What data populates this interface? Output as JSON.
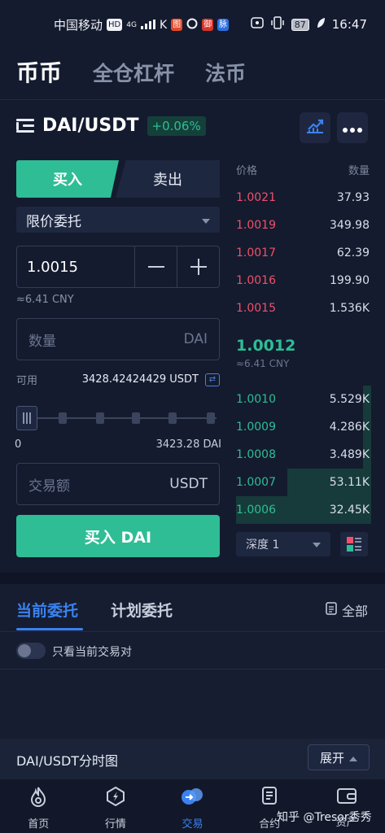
{
  "status_bar": {
    "carrier": "中国移动",
    "hd_badge": "HD",
    "network": "4G",
    "battery": "87",
    "time": "16:47",
    "app_badges": [
      "图",
      "御",
      "脉"
    ]
  },
  "top_tabs": [
    {
      "label": "币币",
      "active": true
    },
    {
      "label": "全仓杠杆",
      "active": false
    },
    {
      "label": "法币",
      "active": false
    }
  ],
  "pair": {
    "name": "DAI/USDT",
    "change": "+0.06%"
  },
  "trade_form": {
    "buy_tab": "买入",
    "sell_tab": "卖出",
    "order_type": "限价委托",
    "price": "1.0015",
    "price_cny": "≈6.41 CNY",
    "qty_placeholder": "数量",
    "qty_unit": "DAI",
    "available_label": "可用",
    "available_value": "3428.42424429 USDT",
    "slider_min": "0",
    "slider_max": "3423.28 DAI",
    "total_placeholder": "交易额",
    "total_unit": "USDT",
    "submit_label": "买入 DAI"
  },
  "order_book": {
    "price_header": "价格",
    "qty_header": "数量",
    "asks": [
      {
        "price": "1.0021",
        "qty": "37.93"
      },
      {
        "price": "1.0019",
        "qty": "349.98"
      },
      {
        "price": "1.0017",
        "qty": "62.39"
      },
      {
        "price": "1.0016",
        "qty": "199.90"
      },
      {
        "price": "1.0015",
        "qty": "1.536K"
      }
    ],
    "last_price": "1.0012",
    "last_price_cny": "≈6.41 CNY",
    "bids": [
      {
        "price": "1.0010",
        "qty": "5.529K",
        "depth": 0.06
      },
      {
        "price": "1.0009",
        "qty": "4.286K",
        "depth": 0.06
      },
      {
        "price": "1.0008",
        "qty": "3.489K",
        "depth": 0.06
      },
      {
        "price": "1.0007",
        "qty": "53.11K",
        "depth": 0.62
      },
      {
        "price": "1.0006",
        "qty": "32.45K",
        "depth": 1.0
      }
    ],
    "depth_label": "深度 1"
  },
  "orders_panel": {
    "tabs": [
      {
        "label": "当前委托",
        "active": true
      },
      {
        "label": "计划委托",
        "active": false
      }
    ],
    "all_label": "全部",
    "filter_label": "只看当前交易对"
  },
  "chart_strip": {
    "title": "DAI/USDT分时图",
    "expand_label": "展开"
  },
  "bottom_nav": [
    {
      "label": "首页",
      "icon": "flame-icon",
      "active": false
    },
    {
      "label": "行情",
      "icon": "compass-icon",
      "active": false
    },
    {
      "label": "交易",
      "icon": "exchange-icon",
      "active": true
    },
    {
      "label": "合约",
      "icon": "contract-icon",
      "active": false
    },
    {
      "label": "资产",
      "icon": "wallet-icon",
      "active": false
    }
  ],
  "watermark": "知乎 @Tresor秀秀",
  "colors": {
    "background": "#141b2e",
    "buy_green": "#2ebd95",
    "sell_red": "#f0506a",
    "accent_blue": "#3a82f0"
  }
}
